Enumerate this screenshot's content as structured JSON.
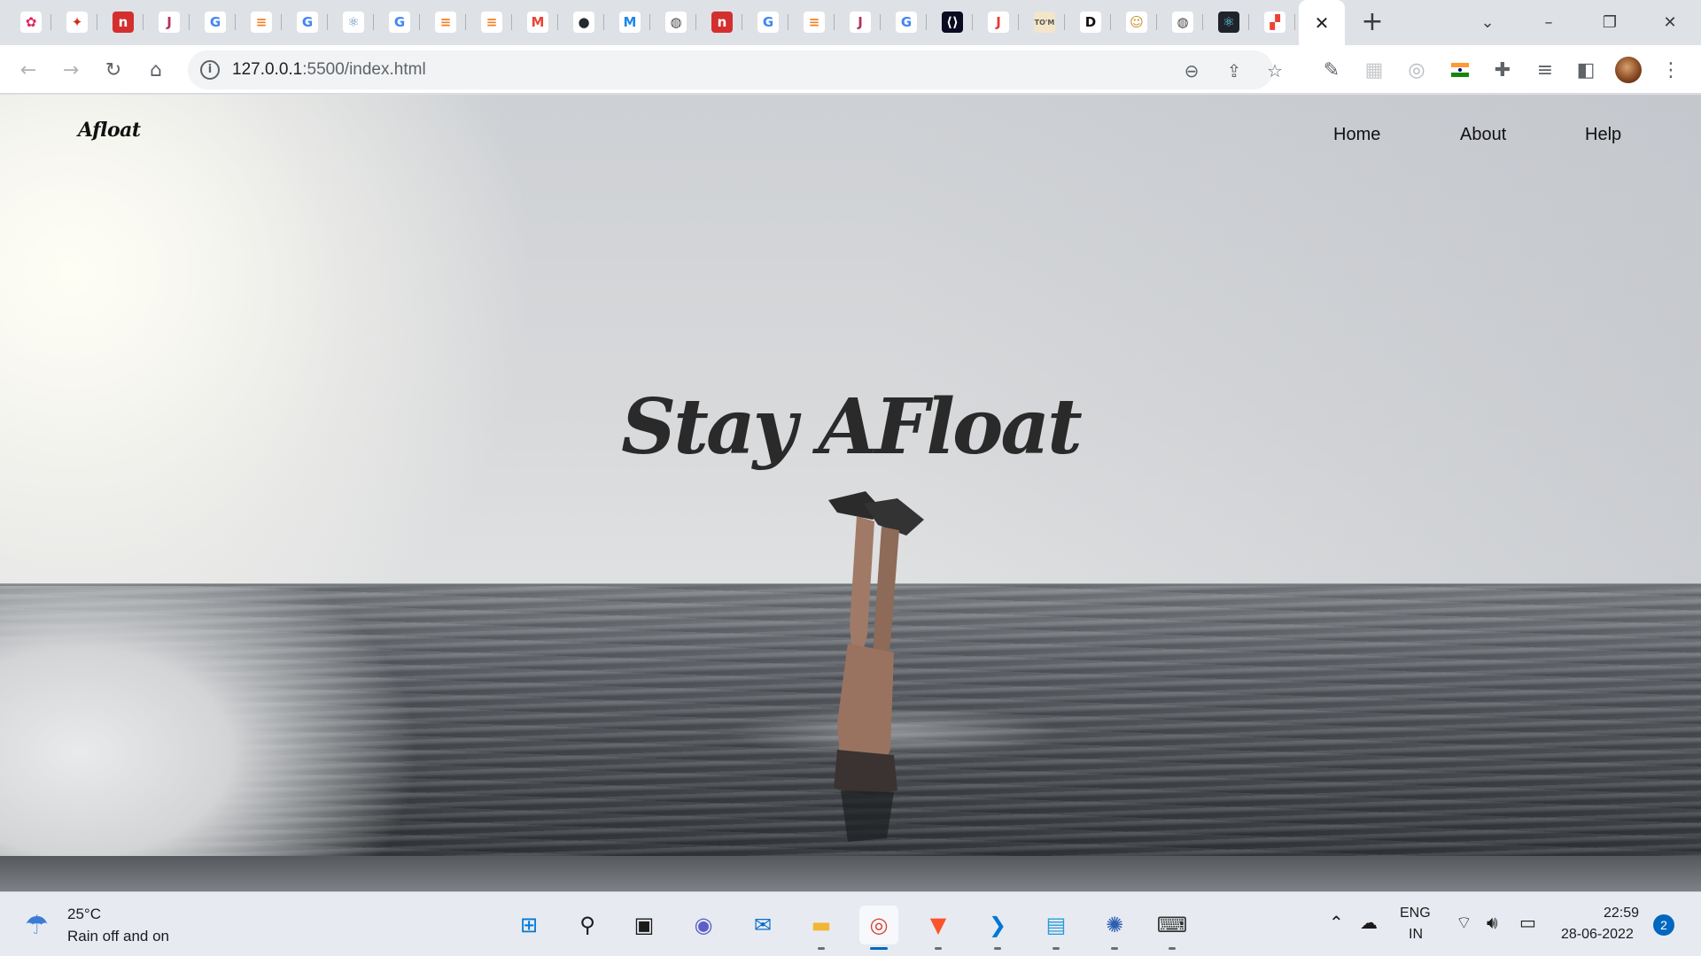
{
  "browser": {
    "tabs": [
      {
        "icon": "octopus-icon",
        "glyph": "✿",
        "bg": "#ffffff",
        "fg": "#e0245e"
      },
      {
        "icon": "maple-leaf-icon",
        "glyph": "✦",
        "bg": "#ffffff",
        "fg": "#d52b1e"
      },
      {
        "icon": "n-logo-icon",
        "glyph": "n",
        "bg": "#d32f2f",
        "fg": "#ffffff"
      },
      {
        "icon": "java-icon",
        "glyph": "J",
        "bg": "#ffffff",
        "fg": "#b0335c"
      },
      {
        "icon": "google-icon",
        "glyph": "G",
        "bg": "#ffffff",
        "fg": "#4285f4"
      },
      {
        "icon": "stackoverflow-icon",
        "glyph": "≡",
        "bg": "#ffffff",
        "fg": "#f48024"
      },
      {
        "icon": "google-icon",
        "glyph": "G",
        "bg": "#ffffff",
        "fg": "#4285f4"
      },
      {
        "icon": "react-icon",
        "glyph": "⚛",
        "bg": "#ffffff",
        "fg": "#5f8fbf"
      },
      {
        "icon": "google-icon",
        "glyph": "G",
        "bg": "#ffffff",
        "fg": "#4285f4"
      },
      {
        "icon": "stackoverflow-icon",
        "glyph": "≡",
        "bg": "#ffffff",
        "fg": "#f48024"
      },
      {
        "icon": "stackoverflow-icon",
        "glyph": "≡",
        "bg": "#ffffff",
        "fg": "#f48024"
      },
      {
        "icon": "gmail-icon",
        "glyph": "M",
        "bg": "#ffffff",
        "fg": "#ea4335"
      },
      {
        "icon": "github-icon",
        "glyph": "●",
        "bg": "#ffffff",
        "fg": "#24292e"
      },
      {
        "icon": "mui-icon",
        "glyph": "M",
        "bg": "#ffffff",
        "fg": "#1e88e5"
      },
      {
        "icon": "globe-icon",
        "glyph": "◍",
        "bg": "#ffffff",
        "fg": "#444444"
      },
      {
        "icon": "n-logo-icon",
        "glyph": "n",
        "bg": "#d32f2f",
        "fg": "#ffffff"
      },
      {
        "icon": "google-icon",
        "glyph": "G",
        "bg": "#ffffff",
        "fg": "#4285f4"
      },
      {
        "icon": "stackoverflow-icon",
        "glyph": "≡",
        "bg": "#ffffff",
        "fg": "#f48024"
      },
      {
        "icon": "java-icon",
        "glyph": "J",
        "bg": "#ffffff",
        "fg": "#b0335c"
      },
      {
        "icon": "google-icon",
        "glyph": "G",
        "bg": "#ffffff",
        "fg": "#4285f4"
      },
      {
        "icon": "freecodecamp-icon",
        "glyph": "⟨⟩",
        "bg": "#0a0a23",
        "fg": "#ffffff"
      },
      {
        "icon": "j-logo-icon",
        "glyph": "J",
        "bg": "#ffffff",
        "fg": "#e53935"
      },
      {
        "icon": "tom-icon",
        "glyph": "TO'M",
        "bg": "#f3e6c8",
        "fg": "#555555"
      },
      {
        "icon": "d-logo-icon",
        "glyph": "D",
        "bg": "#ffffff",
        "fg": "#111111"
      },
      {
        "icon": "avatar-icon",
        "glyph": "☺",
        "bg": "#ffffff",
        "fg": "#c9891c"
      },
      {
        "icon": "globe-icon",
        "glyph": "◍",
        "bg": "#ffffff",
        "fg": "#444444"
      },
      {
        "icon": "react-icon",
        "glyph": "⚛",
        "bg": "#20232a",
        "fg": "#61dafb"
      },
      {
        "icon": "puzzle-color-icon",
        "glyph": "▞",
        "bg": "#ffffff",
        "fg": "#ea4335"
      }
    ],
    "active_tab_close": "✕",
    "new_tab": "+",
    "address": {
      "host": "127.0.0.1",
      "rest": ":5500/index.html"
    }
  },
  "site": {
    "brand": "Afloat",
    "nav": [
      "Home",
      "About",
      "Help"
    ],
    "hero_title": "Stay AFloat"
  },
  "taskbar": {
    "weather": {
      "temp": "25°C",
      "desc": "Rain off and on"
    },
    "apps": [
      {
        "name": "start",
        "glyph": "⊞",
        "color": "#0078d4"
      },
      {
        "name": "search",
        "glyph": "⚲",
        "color": "#1b1b1b"
      },
      {
        "name": "task-view",
        "glyph": "▣",
        "color": "#1b1b1b"
      },
      {
        "name": "teams-chat",
        "glyph": "◉",
        "color": "#5b5fc7"
      },
      {
        "name": "mail",
        "glyph": "✉",
        "color": "#0a6ccf"
      },
      {
        "name": "file-explorer",
        "glyph": "▬",
        "color": "#f2b632"
      },
      {
        "name": "chrome",
        "glyph": "◎",
        "color": "#db4437"
      },
      {
        "name": "brave",
        "glyph": "▼",
        "color": "#fb542b"
      },
      {
        "name": "vscode",
        "glyph": "❯",
        "color": "#0078d4"
      },
      {
        "name": "notepad",
        "glyph": "▤",
        "color": "#2a9dd8"
      },
      {
        "name": "settings-app",
        "glyph": "✺",
        "color": "#2b5fb0"
      },
      {
        "name": "terminal",
        "glyph": "⌨",
        "color": "#333333"
      }
    ],
    "lang_top": "ENG",
    "lang_bottom": "IN",
    "time": "22:59",
    "date": "28-06-2022",
    "notifications": "2"
  }
}
